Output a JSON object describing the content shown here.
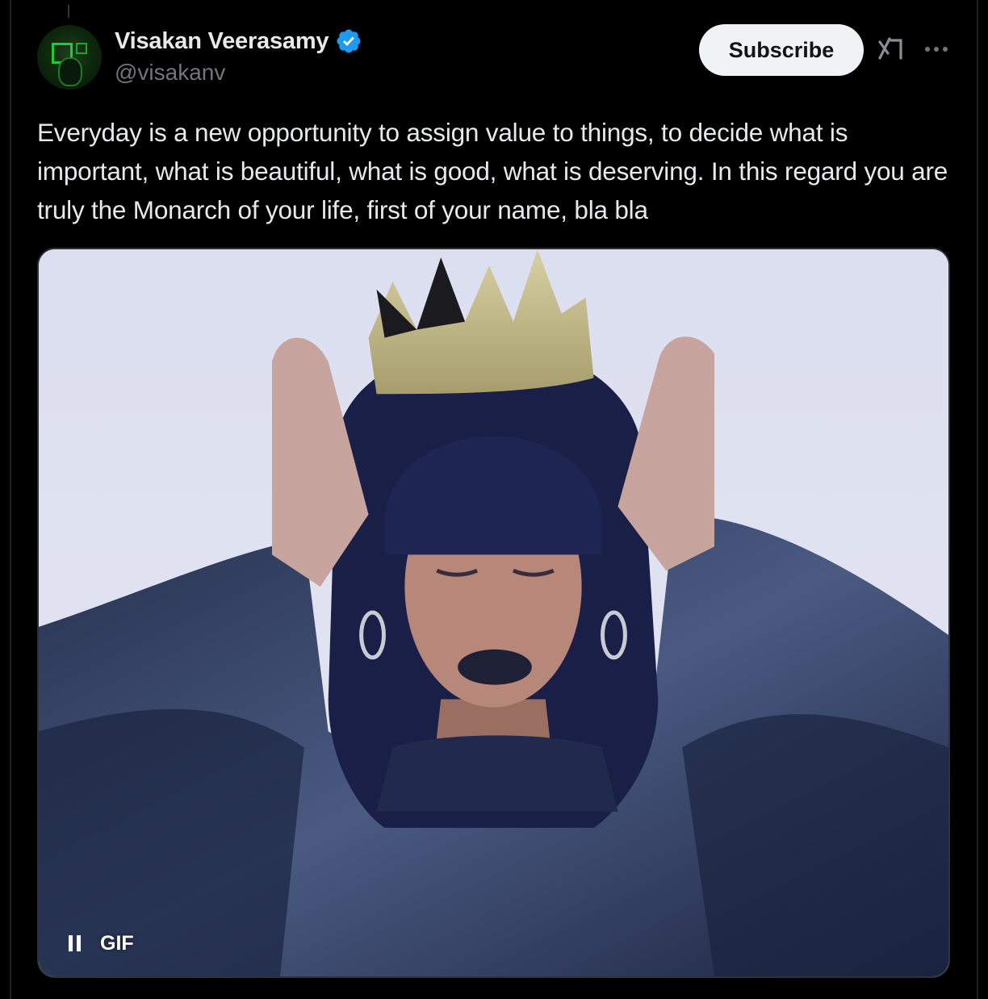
{
  "author": {
    "display_name": "Visakan Veerasamy",
    "handle": "@visakanv",
    "verified": true,
    "avatar_icon": "profile-avatar"
  },
  "actions": {
    "subscribe_label": "Subscribe",
    "grok_icon": "grok-icon",
    "more_icon": "more-options-icon"
  },
  "tweet": {
    "text": "Everyday is a new opportunity to assign value to things, to decide what is important, what is beautiful, what is good, what is deserving. In this regard you are truly the Monarch of your life, first of your name, bla bla"
  },
  "media": {
    "type": "gif",
    "badge_label": "GIF",
    "pause_icon": "pause-icon"
  },
  "colors": {
    "background": "#000000",
    "primary_text": "#e7e9ea",
    "secondary_text": "#71767b",
    "verified_blue": "#1d9bf0",
    "button_bg": "#eff3f4"
  }
}
